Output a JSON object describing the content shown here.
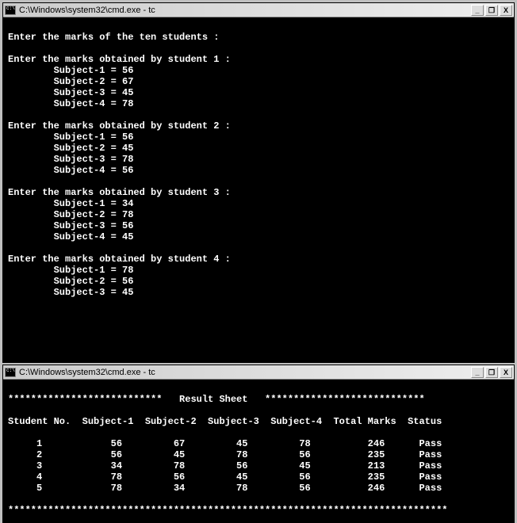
{
  "window1": {
    "title": "C:\\Windows\\system32\\cmd.exe - tc",
    "content": {
      "intro": "Enter the marks of the ten students :",
      "students": [
        {
          "header": "Enter the marks obtained by student 1 :",
          "subjects": [
            {
              "label": "Subject-1 = 56"
            },
            {
              "label": "Subject-2 = 67"
            },
            {
              "label": "Subject-3 = 45"
            },
            {
              "label": "Subject-4 = 78"
            }
          ]
        },
        {
          "header": "Enter the marks obtained by student 2 :",
          "subjects": [
            {
              "label": "Subject-1 = 56"
            },
            {
              "label": "Subject-2 = 45"
            },
            {
              "label": "Subject-3 = 78"
            },
            {
              "label": "Subject-4 = 56"
            }
          ]
        },
        {
          "header": "Enter the marks obtained by student 3 :",
          "subjects": [
            {
              "label": "Subject-1 = 34"
            },
            {
              "label": "Subject-2 = 78"
            },
            {
              "label": "Subject-3 = 56"
            },
            {
              "label": "Subject-4 = 45"
            }
          ]
        },
        {
          "header": "Enter the marks obtained by student 4 :",
          "subjects": [
            {
              "label": "Subject-1 = 78"
            },
            {
              "label": "Subject-2 = 56"
            },
            {
              "label": "Subject-3 = 45"
            }
          ]
        }
      ]
    }
  },
  "window2": {
    "title": "C:\\Windows\\system32\\cmd.exe - tc",
    "content": {
      "divider_top": "***************************   Result Sheet   ****************************",
      "header_row": "Student No.  Subject-1  Subject-2  Subject-3  Subject-4  Total Marks  Status",
      "rows": [
        {
          "no": "1",
          "s1": "56",
          "s2": "67",
          "s3": "45",
          "s4": "78",
          "total": "246",
          "status": "Pass"
        },
        {
          "no": "2",
          "s1": "56",
          "s2": "45",
          "s3": "78",
          "s4": "56",
          "total": "235",
          "status": "Pass"
        },
        {
          "no": "3",
          "s1": "34",
          "s2": "78",
          "s3": "56",
          "s4": "45",
          "total": "213",
          "status": "Pass"
        },
        {
          "no": "4",
          "s1": "78",
          "s2": "56",
          "s3": "45",
          "s4": "56",
          "total": "235",
          "status": "Pass"
        },
        {
          "no": "5",
          "s1": "78",
          "s2": "34",
          "s3": "78",
          "s4": "56",
          "total": "246",
          "status": "Pass"
        }
      ],
      "divider_bottom": "*****************************************************************************"
    }
  },
  "buttons": {
    "minimize": "_",
    "maximize": "❐",
    "close": "X"
  }
}
